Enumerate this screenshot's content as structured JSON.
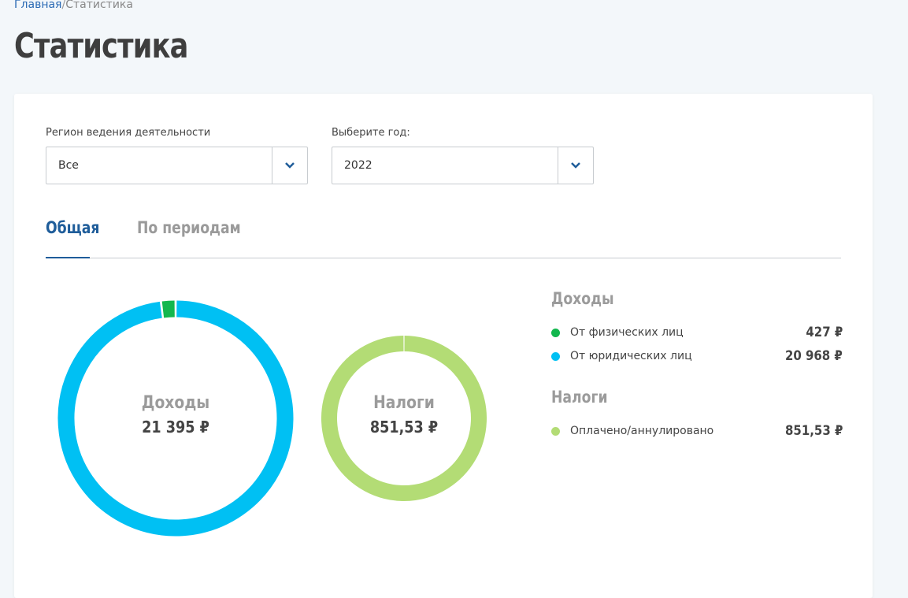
{
  "breadcrumb": {
    "home": "Главная",
    "separator": "/",
    "current": "Статистика"
  },
  "page_title": "Статистика",
  "filters": {
    "region": {
      "label": "Регион ведения деятельности",
      "value": "Все"
    },
    "year": {
      "label": "Выберите год:",
      "value": "2022"
    }
  },
  "tabs": [
    {
      "label": "Общая",
      "active": true
    },
    {
      "label": "По периодам",
      "active": false
    }
  ],
  "donuts": {
    "income": {
      "title": "Доходы",
      "value": "21 395 ₽"
    },
    "taxes": {
      "title": "Налоги",
      "value": "851,53 ₽"
    }
  },
  "legend": {
    "income_heading": "Доходы",
    "taxes_heading": "Налоги",
    "income_items": [
      {
        "label": "От физических лиц",
        "value": "427 ₽",
        "amount": 427,
        "color": "#12b74e"
      },
      {
        "label": "От юридических лиц",
        "value": "20 968 ₽",
        "amount": 20968,
        "color": "#00c0f3"
      }
    ],
    "tax_items": [
      {
        "label": "Оплачено/аннулировано",
        "value": "851,53 ₽",
        "amount": 851.53,
        "color": "#b3dc75"
      }
    ]
  },
  "colors": {
    "accent": "#1f5d9a",
    "link": "#2a6ab4",
    "muted": "#9b9b9b"
  }
}
